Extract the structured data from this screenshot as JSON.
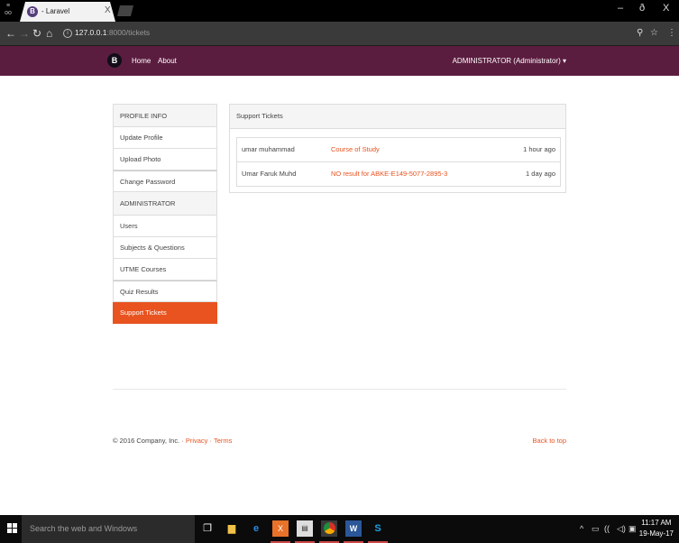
{
  "browser": {
    "tab_favicon": "B",
    "tab_title": "- Laravel",
    "tab_close": "X",
    "url_host": "127.0.0.1",
    "url_path": ":8000/tickets",
    "win_min": "–",
    "win_restore": "ð",
    "win_close": "X",
    "icons": [
      "back-arrow-icon",
      "forward-arrow-icon",
      "reload-icon",
      "home-icon",
      "info-icon",
      "zoom-icon",
      "star-icon",
      "kebab-menu-icon"
    ]
  },
  "navbar": {
    "brand": "B",
    "links": [
      "Home",
      "About"
    ],
    "user": "ADMINISTRATOR (Administrator)",
    "caret": "▾"
  },
  "sidebar": {
    "profile_header": "PROFILE INFO",
    "profile_items": [
      "Update Profile",
      "Upload Photo",
      "Change Password"
    ],
    "admin_header": "ADMINISTRATOR",
    "admin_items": [
      "Users",
      "Subjects & Questions",
      "UTME Courses",
      "Quiz Results",
      "Support Tickets"
    ],
    "active": "Support Tickets"
  },
  "panel": {
    "title": "Support Tickets",
    "tickets": [
      {
        "user": "umar muhammad",
        "subject": "Course of Study",
        "time": "1 hour ago"
      },
      {
        "user": "Umar Faruk Muhd",
        "subject": "NO result for ABKE-E149-5077-2895-3",
        "time": "1 day ago"
      }
    ]
  },
  "footer": {
    "copyright": "© 2016 Company, Inc. · ",
    "privacy": "Privacy",
    "sep": " · ",
    "terms": "Terms",
    "back_to_top": "Back to top"
  },
  "taskbar": {
    "search_placeholder": "Search the web and Windows",
    "time": "11:17 AM",
    "date": "19-May-17"
  },
  "colors": {
    "navbar": "#5b1d3f",
    "accent": "#e8531f",
    "brand": "#563d7c"
  }
}
